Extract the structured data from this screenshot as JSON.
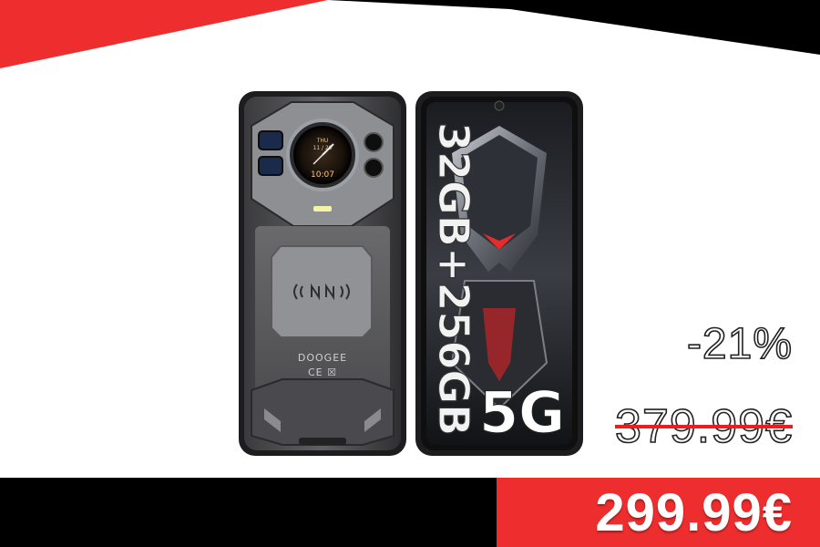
{
  "promo": {
    "discount": "-21%",
    "old_price": "379.99€",
    "final_price": "299.99€"
  },
  "product": {
    "brand_mark": "DOOGEE",
    "cert_marks": "CE ☒",
    "clock": {
      "day": "THU",
      "date": "11 / 29",
      "time": "10:07"
    },
    "spec_memory": "32GB+256GB",
    "spec_network": "5G"
  },
  "colors": {
    "accent_red": "#ee2e2e",
    "banner_black": "#000000",
    "background": "#ffffff"
  }
}
